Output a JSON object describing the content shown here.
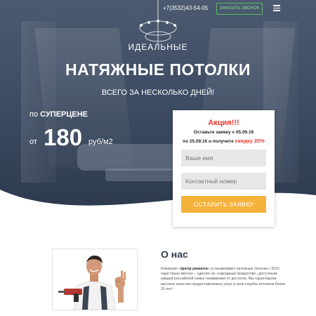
{
  "header": {
    "phone": "+7(3532)43-54-05",
    "callback_label": "ЗАКАЗАТЬ ЗВОНОК",
    "menu_icon": "hamburger-menu-icon"
  },
  "hero": {
    "pre_title": "ИДЕАЛЬНЫЕ",
    "title": "НАТЯЖНЫЕ ПОТОЛКИ",
    "subtitle": "ВСЕГО ЗА НЕСКОЛЬКО ДНЕЙ!",
    "price_prefix": "по",
    "price_highlight": "СУПЕРЦЕНЕ",
    "price_from": "от",
    "price_value": "180",
    "price_unit": "руб/м2"
  },
  "promo_form": {
    "title": "Акция!!!",
    "line1": "Оставьте заявку с 05.09.16",
    "line2_prefix": "по 25.09.16 и получите",
    "discount": "скидку 20%",
    "name_placeholder": "Ваше имя",
    "phone_placeholder": "Контактный номер",
    "submit_label": "ОСТАВИТЬ ЗАЯВКУ"
  },
  "about": {
    "title": "О нас",
    "text_prefix": "Компания «",
    "company": "Центр ремонта",
    "text_rest": "» устанавливает натяжные потолки с 2010 года! Наша миссия – сделать их «народным продуктом», доступным каждой российской семье независимо от достатка. Мы гарантируем высокое качество предоставляемых услуг и срок службы потолков более 20 лет!"
  },
  "colors": {
    "accent_red": "#e8392f",
    "button_orange": "#f6b33b",
    "callback_green": "#5dbb63",
    "heading_dark": "#303a4f"
  }
}
